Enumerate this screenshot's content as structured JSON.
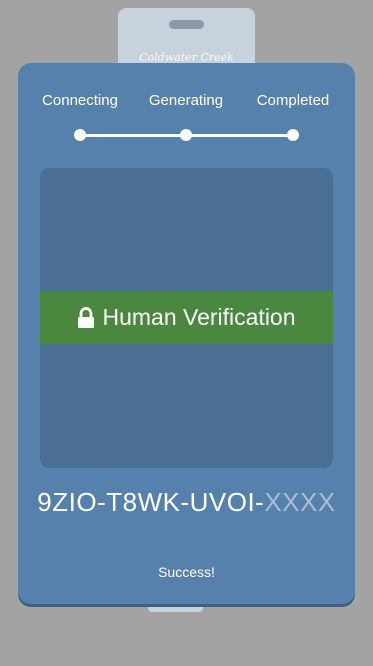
{
  "background_card": {
    "brand_text": "Coldwater Creek"
  },
  "steps": [
    {
      "label": "Connecting"
    },
    {
      "label": "Generating"
    },
    {
      "label": "Completed"
    }
  ],
  "verification": {
    "button_label": "Human Verification",
    "button_icon": "lock-icon",
    "button_color": "#4a8840"
  },
  "code": {
    "visible": "9ZIO-T8WK-UVOI-",
    "masked": "XXXX"
  },
  "status": {
    "text": "Success!"
  },
  "colors": {
    "page_background": "#a3a3a3",
    "modal": "#5781ad",
    "panel": "#4b6f94",
    "masked_code": "#a9bdd3"
  }
}
